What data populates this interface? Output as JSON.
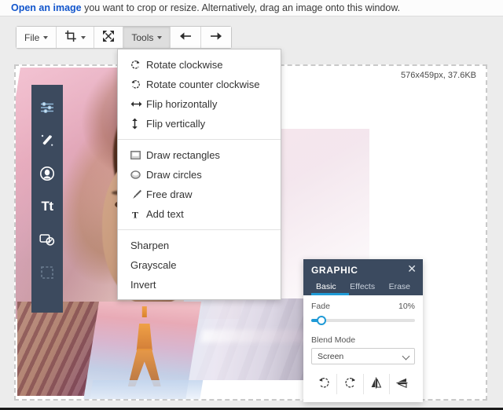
{
  "notice": {
    "link_text": "Open an image",
    "rest_text": " you want to crop or resize. Alternatively, drag an image onto this window."
  },
  "toolbar": {
    "file_label": "File",
    "crop_icon": "crop-icon",
    "resize_icon": "resize-icon",
    "tools_label": "Tools",
    "undo_icon": "undo-arrow-icon",
    "redo_icon": "redo-arrow-icon"
  },
  "canvas": {
    "dimensions_text": "576x459px, 37.6KB"
  },
  "rail": {
    "items": [
      {
        "name": "adjust-sliders-icon",
        "label": ""
      },
      {
        "name": "magic-wand-icon",
        "label": ""
      },
      {
        "name": "portrait-retouch-icon",
        "label": ""
      },
      {
        "name": "text-tool-icon",
        "label": "Tt"
      },
      {
        "name": "sticker-icon",
        "label": ""
      },
      {
        "name": "frame-icon",
        "label": ""
      }
    ]
  },
  "tools_menu": {
    "groups": [
      {
        "items": [
          {
            "icon": "rotate-clockwise-icon",
            "label": "Rotate clockwise"
          },
          {
            "icon": "rotate-counter-clockwise-icon",
            "label": "Rotate counter clockwise"
          },
          {
            "icon": "flip-horizontal-icon",
            "label": "Flip horizontally"
          },
          {
            "icon": "flip-vertical-icon",
            "label": "Flip vertically"
          }
        ]
      },
      {
        "items": [
          {
            "icon": "rectangle-icon",
            "label": "Draw rectangles"
          },
          {
            "icon": "circle-icon",
            "label": "Draw circles"
          },
          {
            "icon": "brush-icon",
            "label": "Free draw"
          },
          {
            "icon": "text-icon",
            "label": "Add text"
          }
        ]
      },
      {
        "items": [
          {
            "icon": "",
            "label": "Sharpen"
          },
          {
            "icon": "",
            "label": "Grayscale"
          },
          {
            "icon": "",
            "label": "Invert"
          }
        ]
      }
    ]
  },
  "graphic_panel": {
    "title": "GRAPHIC",
    "close_icon": "close-icon",
    "tabs": [
      {
        "label": "Basic",
        "active": true
      },
      {
        "label": "Effects",
        "active": false
      },
      {
        "label": "Erase",
        "active": false
      }
    ],
    "fade": {
      "label": "Fade",
      "value_text": "10%",
      "value": 10
    },
    "blend_mode": {
      "label": "Blend Mode",
      "selected": "Screen"
    },
    "actions": [
      {
        "icon": "rotate-counter-clockwise-icon",
        "label": ""
      },
      {
        "icon": "rotate-clockwise-icon",
        "label": ""
      },
      {
        "icon": "flip-horizontal-icon",
        "label": ""
      },
      {
        "icon": "flip-vertical-icon",
        "label": ""
      }
    ]
  },
  "colors": {
    "accent": "#1f9ad6",
    "panel_header": "#3b4a5f",
    "rail": "#3c4a5e",
    "link": "#1155cc"
  }
}
